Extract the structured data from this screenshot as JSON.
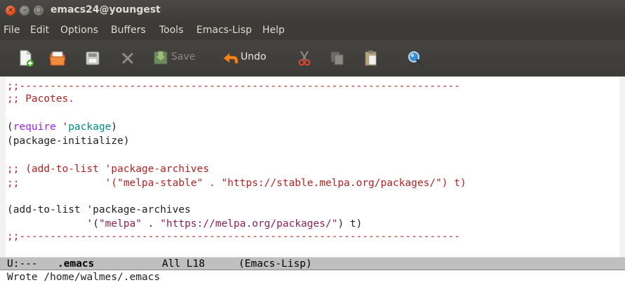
{
  "window": {
    "title": "emacs24@youngest",
    "controls": {
      "close_glyph": "×",
      "minimize_glyph": "–",
      "maximize_glyph": "□"
    }
  },
  "menu": {
    "items": [
      "File",
      "Edit",
      "Options",
      "Buffers",
      "Tools",
      "Emacs-Lisp",
      "Help"
    ]
  },
  "toolbar": {
    "buttons": [
      {
        "name": "new-file",
        "icon": "new-file-icon",
        "label": ""
      },
      {
        "name": "open-directory",
        "icon": "folder-icon",
        "label": ""
      },
      {
        "name": "save-file",
        "icon": "save-disk-icon",
        "label": ""
      },
      {
        "name": "close-buffer",
        "icon": "close-x-icon",
        "label": ""
      },
      {
        "name": "save",
        "icon": "save-icon",
        "label": "Save",
        "enabled": false
      },
      {
        "name": "undo",
        "icon": "undo-arrow-icon",
        "label": "Undo",
        "enabled": true
      },
      {
        "name": "cut",
        "icon": "scissors-icon",
        "label": ""
      },
      {
        "name": "copy",
        "icon": "copy-icon",
        "label": ""
      },
      {
        "name": "paste",
        "icon": "clipboard-icon",
        "label": ""
      },
      {
        "name": "search",
        "icon": "magnifier-icon",
        "label": ""
      }
    ],
    "save_label": "Save",
    "undo_label": "Undo"
  },
  "editor": {
    "line1": ";;------------------------------------------------------------------------",
    "line2": ";; Pacotes.",
    "line4_open": "(",
    "line4_kw": "require",
    "line4_space": " '",
    "line4_const": "package",
    "line4_close": ")",
    "line5": "(package-initialize)",
    "line7": ";; (add-to-list 'package-archives",
    "line8": ";;              '(\"melpa-stable\" . \"https://stable.melpa.org/packages/\") t)",
    "line10": "(add-to-list 'package-archives",
    "line11_pre": "             '(",
    "line11_str1": "\"melpa\"",
    "line11_mid": " . ",
    "line11_str2": "\"https://melpa.org/packages/\"",
    "line11_post": ") t)",
    "line12": ";;------------------------------------------------------------------------"
  },
  "modeline": {
    "status": "U:---",
    "buffer": ".emacs",
    "position": "All L18",
    "mode": "(Emacs-Lisp)"
  },
  "echo": {
    "message": "Wrote /home/walmes/.emacs"
  },
  "colors": {
    "chrome": "#3c3b37",
    "comment": "#b22222",
    "keyword": "#a020f0",
    "constant": "#008b8b",
    "string": "#8b2252",
    "modeline": "#bfbfbf"
  }
}
